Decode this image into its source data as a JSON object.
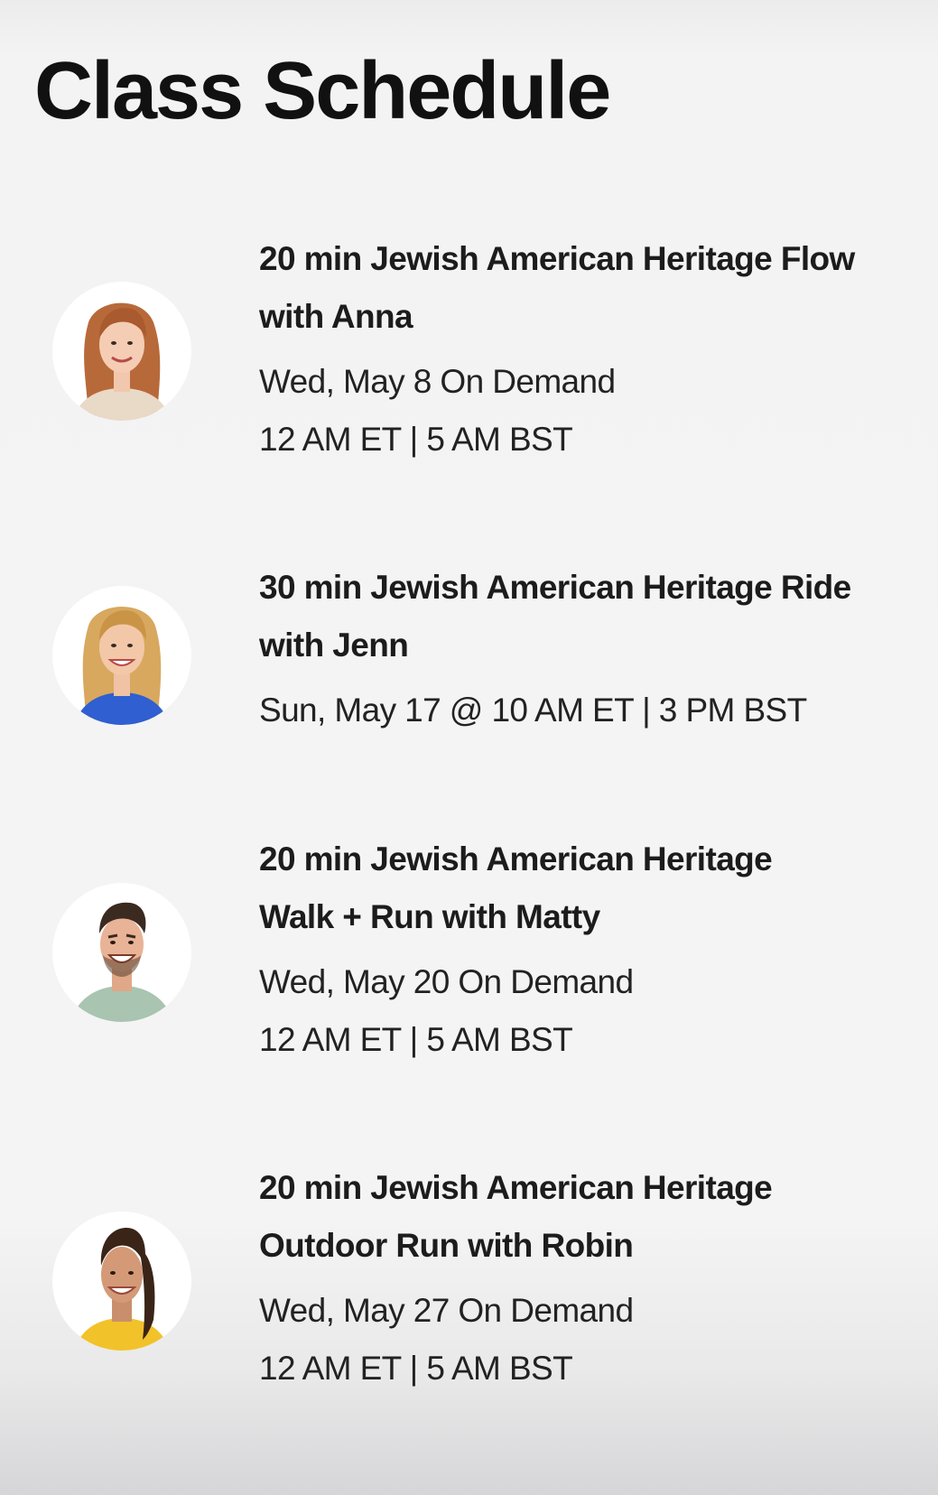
{
  "page": {
    "title": "Class Schedule"
  },
  "classes": [
    {
      "title_line1": "20 min Jewish American Heritage Flow",
      "title_line2": "with Anna",
      "schedule_line1": "Wed, May 8 On Demand",
      "schedule_line2": "12 AM ET | 5 AM BST",
      "avatar_icon": "instructor-anna-photo",
      "hair_color": "#b8693a",
      "top_color": "#e9d9c7"
    },
    {
      "title_line1": "30 min Jewish American Heritage Ride",
      "title_line2": "with Jenn",
      "schedule_line1": "Sun, May 17 @ 10 AM ET | 3 PM BST",
      "schedule_line2": "",
      "avatar_icon": "instructor-jenn-photo",
      "hair_color": "#d8a85f",
      "top_color": "#2f5fd0"
    },
    {
      "title_line1": "20 min Jewish American Heritage",
      "title_line2": "Walk + Run with  Matty",
      "schedule_line1": "Wed, May 20 On Demand",
      "schedule_line2": "12 AM ET | 5 AM BST",
      "avatar_icon": "instructor-matty-photo",
      "hair_color": "#3b2a20",
      "top_color": "#a9c4b0"
    },
    {
      "title_line1": "20 min Jewish American Heritage",
      "title_line2": "Outdoor Run with Robin",
      "schedule_line1": "Wed, May 27 On Demand",
      "schedule_line2": "12 AM ET | 5 AM BST",
      "avatar_icon": "instructor-robin-photo",
      "hair_color": "#3a2418",
      "top_color": "#f2c22a"
    }
  ]
}
